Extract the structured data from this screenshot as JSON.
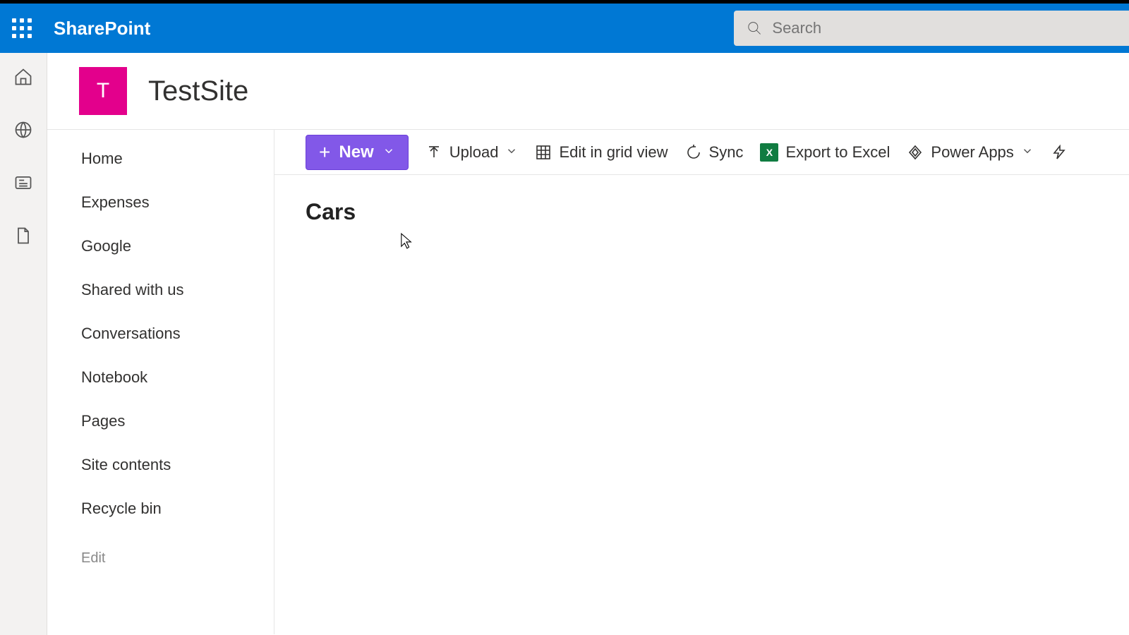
{
  "suite": {
    "brand": "SharePoint"
  },
  "search": {
    "placeholder": "Search"
  },
  "site": {
    "initial": "T",
    "title": "TestSite"
  },
  "nav": {
    "items": [
      "Home",
      "Expenses",
      "Google",
      "Shared with us",
      "Conversations",
      "Notebook",
      "Pages",
      "Site contents",
      "Recycle bin"
    ],
    "edit": "Edit"
  },
  "commands": {
    "new": "New",
    "upload": "Upload",
    "edit_grid": "Edit in grid view",
    "sync": "Sync",
    "export": "Export to Excel",
    "power_apps": "Power Apps"
  },
  "list": {
    "title": "Cars"
  },
  "colors": {
    "accent": "#0078d4",
    "siteLogo": "#e3008c",
    "newButton": "#8258e8",
    "excel": "#107c41"
  }
}
